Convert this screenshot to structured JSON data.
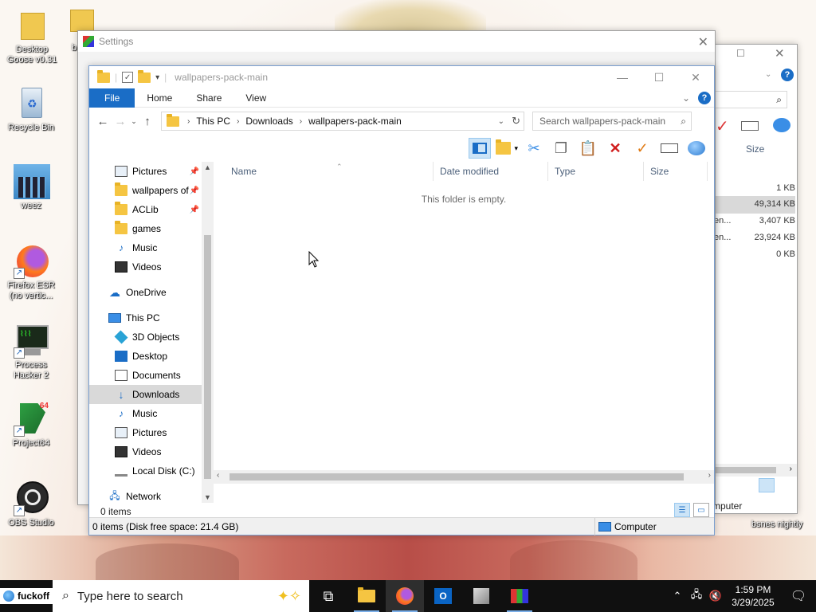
{
  "desktop": {
    "icons": [
      {
        "label": "Desktop\nGoose v0.31"
      },
      {
        "label": "b"
      },
      {
        "label": "Recycle Bin"
      },
      {
        "label": "weez"
      },
      {
        "label": "Firefox ESR\n(no vertic..."
      },
      {
        "label": "Process\nHacker 2"
      },
      {
        "label": "Project64"
      },
      {
        "label": "OBS Studio"
      },
      {
        "label": "bsnes nightly"
      }
    ]
  },
  "settings_window": {
    "title": "Settings",
    "close_glyph": "✕"
  },
  "back_window": {
    "size_header": "Size",
    "sizes": [
      "1 KB",
      "49,314 KB",
      "3,407 KB",
      "23,924 KB",
      "0 KB"
    ],
    "type_snips": [
      "en...",
      "en..."
    ],
    "status_text": "mputer"
  },
  "explorer": {
    "title": "wallpapers-pack-main",
    "ribbon_tabs": [
      "File",
      "Home",
      "Share",
      "View"
    ],
    "address": {
      "crumbs": [
        "This PC",
        "Downloads",
        "wallpapers-pack-main"
      ]
    },
    "search_placeholder": "Search wallpapers-pack-main",
    "nav_items": [
      {
        "label": "Pictures",
        "pinned": true
      },
      {
        "label": "wallpapers of",
        "pinned": true
      },
      {
        "label": "ACLib",
        "pinned": true
      },
      {
        "label": "games",
        "pinned": false
      },
      {
        "label": "Music",
        "pinned": false
      },
      {
        "label": "Videos",
        "pinned": false
      },
      {
        "label": "OneDrive"
      },
      {
        "label": "This PC"
      },
      {
        "label": "3D Objects"
      },
      {
        "label": "Desktop"
      },
      {
        "label": "Documents"
      },
      {
        "label": "Downloads",
        "selected": true
      },
      {
        "label": "Music"
      },
      {
        "label": "Pictures"
      },
      {
        "label": "Videos"
      },
      {
        "label": "Local Disk (C:)"
      },
      {
        "label": "Network"
      }
    ],
    "columns": [
      "Name",
      "Date modified",
      "Type",
      "Size"
    ],
    "empty_message": "This folder is empty.",
    "items_count": "0 items",
    "status": {
      "left": "0 items (Disk free space: 21.4 GB)",
      "right": "Computer"
    }
  },
  "taskbar": {
    "start_label": "fuckoff",
    "search_placeholder": "Type here to search",
    "clock_time": "1:59 PM",
    "clock_date": "3/29/2025"
  },
  "colors": {
    "accent": "#1a6dc6",
    "taskbar": "#101010"
  }
}
